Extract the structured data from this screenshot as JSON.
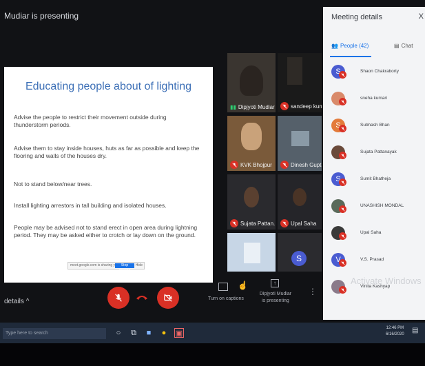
{
  "presenting_label": "Mudiar is presenting",
  "slide": {
    "title": "Educating people about of lighting",
    "bullets": [
      "Advise the people to restrict their movement outside during thunderstorm periods.",
      "Advise them to stay inside houses, huts as far as possible and keep the flooring and walls of the houses dry.",
      "Not to stand below/near trees.",
      "Install lighting arrestors in tall building and isolated houses.",
      "People may be advised not to stand erect in open area during lightning period. They may be asked either to crotch or lay down on the ground."
    ],
    "share_bar_text": "meet.google.com is sharing your screen.",
    "share_bar_button": "Stop sharing",
    "share_bar_hide": "Hide"
  },
  "tiles": {
    "t1": "Dipjyoti Mudiar",
    "t2": "sandeep kum...",
    "t3": "KVK Bhojpur",
    "t4": "Dinesh Gupta",
    "t5": "Sujata Pattan...",
    "t6": "Upal Saha",
    "t8_avatar": "S"
  },
  "controls": {
    "details_label": "details",
    "captions_label": "Turn on captions",
    "presenting_line1": "Dipjyoti Mudiar",
    "presenting_line2": "is presenting"
  },
  "panel": {
    "title": "Meeting details",
    "close": "X",
    "people_tab": "People (42)",
    "chat_tab": "Chat",
    "people": [
      {
        "initial": "S",
        "name": "Shaon Chakraborty",
        "color": "#4a5cd1"
      },
      {
        "initial": "",
        "name": "sneha kumari",
        "color": "#d98a6a"
      },
      {
        "initial": "S",
        "name": "Subhash Bhan",
        "color": "#e37b3b"
      },
      {
        "initial": "",
        "name": "Sujata Pattanayak",
        "color": "#6a4a3a"
      },
      {
        "initial": "S",
        "name": "Sumit Bhatheja",
        "color": "#4a5cd1"
      },
      {
        "initial": "",
        "name": "UNASHISH MONDAL",
        "color": "#5a6a5a"
      },
      {
        "initial": "",
        "name": "Upal Saha",
        "color": "#3a3a3a"
      },
      {
        "initial": "V",
        "name": "V.S. Prasad",
        "color": "#4a5cd1"
      },
      {
        "initial": "",
        "name": "Vinita Kashyap",
        "color": "#8a7a8a"
      }
    ],
    "watermark": "Activate Windows"
  },
  "taskbar": {
    "search_placeholder": "Type here to search",
    "time": "12:46 PM",
    "date": "6/16/2020"
  }
}
